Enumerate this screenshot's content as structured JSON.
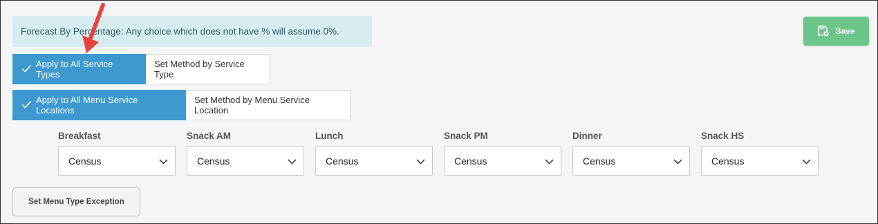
{
  "info_message": "Forecast By Percentage: Any choice which does not have % will assume 0%.",
  "save_button": {
    "label": "Save",
    "icon": "save-icon",
    "color": "#6cc58a"
  },
  "service_types_toggle": {
    "active": "Apply to All Service Types",
    "inactive": "Set Method by Service Type"
  },
  "locations_toggle": {
    "active": "Apply to All Menu Service Locations",
    "inactive": "Set Method by Menu Service Location"
  },
  "meals": [
    {
      "label": "Breakfast",
      "value": "Census"
    },
    {
      "label": "Snack AM",
      "value": "Census"
    },
    {
      "label": "Lunch",
      "value": "Census"
    },
    {
      "label": "Snack PM",
      "value": "Census"
    },
    {
      "label": "Dinner",
      "value": "Census"
    },
    {
      "label": "Snack HS",
      "value": "Census"
    }
  ],
  "exception_button": "Set Menu Type Exception",
  "colors": {
    "active_toggle": "#3d99d0",
    "info_bg": "#d6ecf0",
    "annotation_arrow": "#e8433d"
  }
}
